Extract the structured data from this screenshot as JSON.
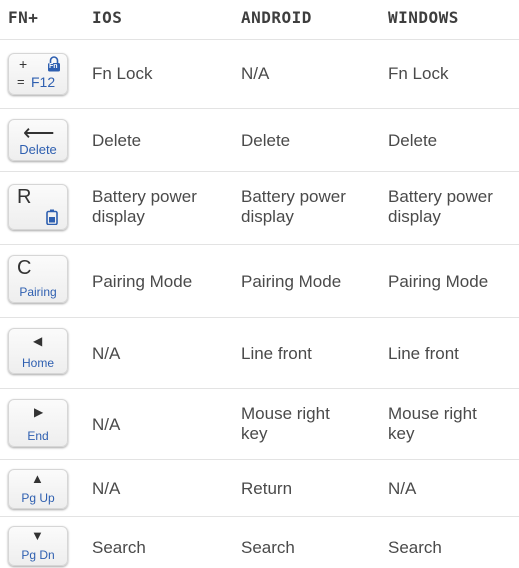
{
  "headers": {
    "fn": "FN+",
    "ios": "IOS",
    "android": "ANDROID",
    "windows": "WINDOWS"
  },
  "rows": [
    {
      "key": {
        "top_left": "+",
        "bottom_left": "=",
        "blue_label": "F12",
        "icon": "fn-lock-icon",
        "icon_text": "Fn"
      },
      "ios": "Fn Lock",
      "android": "N/A",
      "windows": "Fn Lock"
    },
    {
      "key": {
        "glyph": "⟵",
        "blue_label": "Delete"
      },
      "ios": "Delete",
      "android": "Delete",
      "windows": "Delete"
    },
    {
      "key": {
        "letter": "R",
        "icon": "battery-icon"
      },
      "ios": "Battery power display",
      "android": "Battery power display",
      "windows": "Battery power display"
    },
    {
      "key": {
        "letter": "C",
        "blue_label": "Pairing"
      },
      "ios": "Pairing Mode",
      "android": "Pairing Mode",
      "windows": "Pairing Mode"
    },
    {
      "key": {
        "glyph": "◀",
        "blue_label": "Home"
      },
      "ios": "N/A",
      "android": "Line front",
      "windows": "Line front"
    },
    {
      "key": {
        "glyph": "▶",
        "blue_label": "End"
      },
      "ios": "N/A",
      "android": "Mouse right key",
      "windows": "Mouse right key"
    },
    {
      "key": {
        "glyph": "▲",
        "blue_label": "Pg Up"
      },
      "ios": "N/A",
      "android": "Return",
      "windows": "N/A"
    },
    {
      "key": {
        "glyph": "▼",
        "blue_label": "Pg Dn"
      },
      "ios": "Search",
      "android": "Search",
      "windows": "Search"
    }
  ],
  "colors": {
    "key_label": "#2e5fb0",
    "text": "#4a4a4a",
    "divider": "#e3e3e3"
  }
}
